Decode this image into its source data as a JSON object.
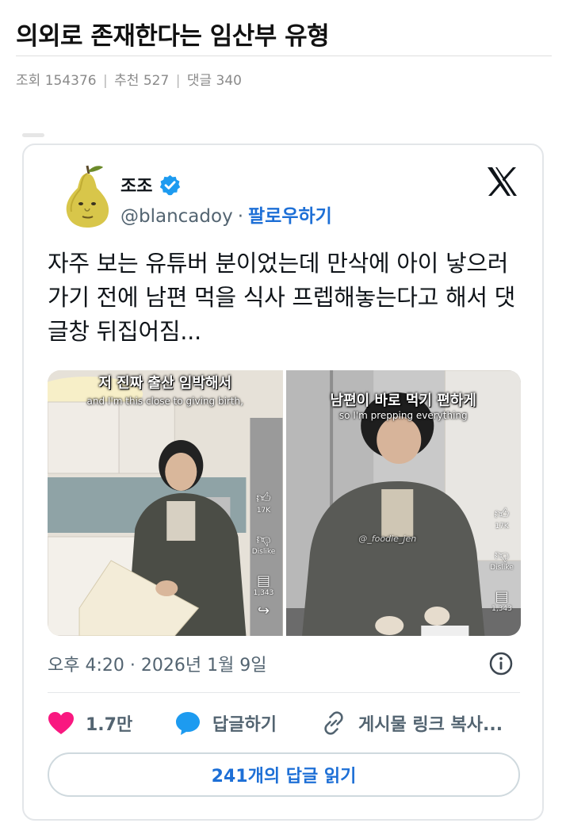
{
  "post": {
    "title": "의외로 존재한다는 임산부 유형",
    "views_label": "조회",
    "views": "154376",
    "recommend_label": "추천",
    "recommend": "527",
    "comments_label": "댓글",
    "comments": "340"
  },
  "tweet": {
    "display_name": "조조",
    "handle": "@blancadoy",
    "follow_label": "팔로우하기",
    "text": "자주 보는 유튜버 분이었는데 만삭에 아이 낳으러 가기 전에 남편 먹을 식사 프렙해놓는다고 해서 댓글창 뒤집어짐...",
    "media": [
      {
        "caption_ko": "저 진짜 출산 임박해서",
        "caption_en": "and I'm this close to giving birth,",
        "likes": "17K",
        "dislike_label": "Dislike",
        "comments": "1,343"
      },
      {
        "caption_ko": "남편이 바로 먹기 편하게",
        "caption_en": "so I'm prepping everything",
        "watermark": "@_foodie_jen",
        "likes": "17K",
        "dislike_label": "Dislike",
        "comments": "1,343"
      }
    ],
    "timestamp": "오후 4:20 · 2026년 1월 9일",
    "likes": "1.7만",
    "reply_label": "답글하기",
    "copy_link_label": "게시물 링크 복사...",
    "read_replies_label": "241개의 답글 읽기"
  },
  "icons": {
    "verified": "verified-badge-icon",
    "x_logo": "x-logo-icon",
    "info": "info-icon",
    "heart": "heart-icon",
    "reply": "speech-bubble-icon",
    "link": "link-icon"
  },
  "colors": {
    "accent_blue": "#1d6fd6",
    "verified_blue": "#1d9bf0",
    "heart_pink": "#f91880",
    "muted_text": "#536471"
  }
}
